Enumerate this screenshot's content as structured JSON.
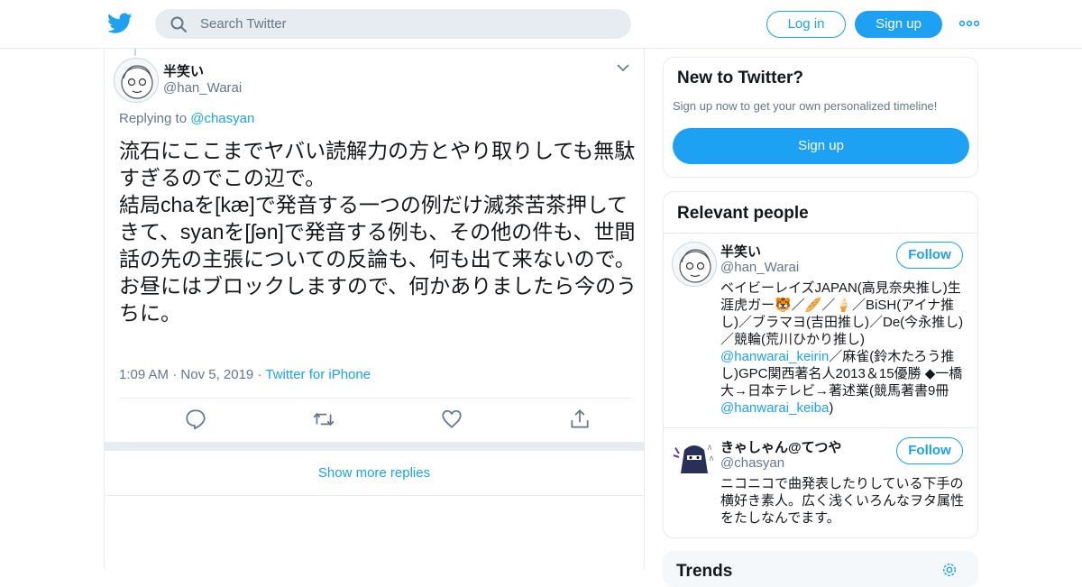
{
  "header": {
    "search_placeholder": "Search Twitter",
    "login_label": "Log in",
    "signup_label": "Sign up",
    "brand_color": "#1da1f2"
  },
  "tweet": {
    "name": "半笑い",
    "handle": "@han_Warai",
    "replying_prefix": "Replying to",
    "replying_to": "@chasyan",
    "text": "流石にここまでヤバい読解力の方とやり取りしても無駄すぎるのでこの辺で。\n結局chaを[kæ]で発音する一つの例だけ滅茶苦茶押してきて、syanを[ʃən]で発音する例も、その他の件も、世間話の先の主張についての反論も、何も出て来ないので。\nお昼にはブロックしますので、何かありましたら今のうちに。",
    "time": "1:09 AM",
    "date": "Nov 5, 2019",
    "source": "Twitter for iPhone",
    "separator": "·",
    "actions": [
      "reply-icon",
      "retweet-icon",
      "like-icon",
      "share-icon"
    ]
  },
  "show_more": "Show more replies",
  "new_to_twitter": {
    "title": "New to Twitter?",
    "subtitle": "Sign up now to get your own personalized timeline!",
    "button": "Sign up"
  },
  "relevant_people": {
    "title": "Relevant people",
    "people": [
      {
        "name": "半笑い",
        "handle": "@han_Warai",
        "follow": "Follow",
        "bio_parts": [
          "ベイビーレイズJAPAN(高見奈央推し)生涯虎ガー🐯／🥖／🍦／BiSH(アイナ推し)／ブラマヨ(吉田推し)／De(今永推し)／競輪(荒川ひかり推し) ",
          "@hanwarai_keirin",
          "／麻雀(鈴木たろう推し)GPC関西著名人2013＆15優勝 ◆一橋大→日本テレビ→著述業(競馬著書9冊 ",
          "@hanwarai_keiba",
          ")"
        ]
      },
      {
        "name": "きゃしゃん@てつや",
        "handle": "@chasyan",
        "follow": "Follow",
        "bio": "ニコニコで曲発表したりしている下手の横好き素人。広く浅くいろんなヲタ属性をたしなんでます。"
      }
    ]
  },
  "trends": {
    "title": "Trends"
  }
}
